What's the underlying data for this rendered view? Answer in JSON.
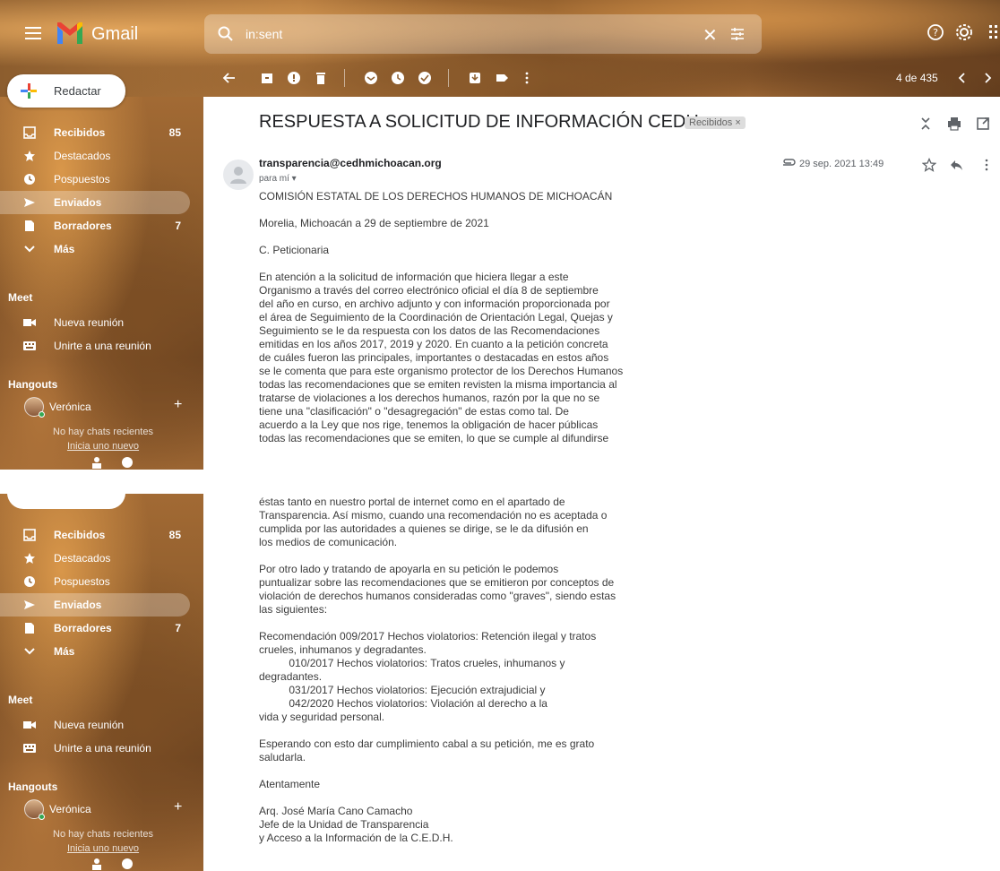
{
  "app": {
    "name": "Gmail"
  },
  "search": {
    "value": "in:sent"
  },
  "pager": {
    "text": "4 de 435"
  },
  "compose": {
    "label": "Redactar"
  },
  "nav": [
    {
      "label": "Recibidos",
      "count": "85"
    },
    {
      "label": "Destacados",
      "count": ""
    },
    {
      "label": "Pospuestos",
      "count": ""
    },
    {
      "label": "Enviados",
      "count": ""
    },
    {
      "label": "Borradores",
      "count": "7"
    },
    {
      "label": "Más",
      "count": ""
    }
  ],
  "meet": {
    "title": "Meet",
    "new_meeting": "Nueva reunión",
    "join_meeting": "Unirte a una reunión"
  },
  "hangouts": {
    "title": "Hangouts",
    "user": "Verónica",
    "no_chats": "No hay chats recientes",
    "start_new": "Inicia uno nuevo"
  },
  "email": {
    "subject": "RESPUESTA A SOLICITUD DE INFORMACIÓN CEDH",
    "label_chip": "Recibidos ×",
    "sender": "transparencia@cedhmichoacan.org",
    "recipient": "para mí ▾",
    "date": "29 sep. 2021 13:49",
    "body_part1": "COMISIÓN ESTATAL DE LOS DERECHOS HUMANOS DE MICHOACÁN\n\nMorelia, Michoacán a 29 de septiembre de 2021\n\nC. Peticionaria\n\nEn atención a la solicitud de información que hiciera llegar a este\nOrganismo a través del correo electrónico oficial el día 8 de septiembre\ndel año en curso, en archivo adjunto y con información proporcionada por\nel área de Seguimiento de la Coordinación de Orientación Legal, Quejas y\nSeguimiento se le da respuesta con los datos de las Recomendaciones\nemitidas en los años 2017, 2019 y 2020. En cuanto a la petición concreta\nde cuáles fueron las principales, importantes o destacadas en estos años\nse le comenta que para este organismo protector de los Derechos Humanos\ntodas las recomendaciones que se emiten revisten la misma importancia al\ntratarse de violaciones a los derechos humanos, razón por la que no se\ntiene una \"clasificación\" o \"desagregación\" de estas como tal. De\nacuerdo a la Ley que nos rige, tenemos la obligación de hacer públicas\ntodas las recomendaciones que se emiten, lo que se cumple al difundirse",
    "body_part2": "éstas tanto en nuestro portal de internet como en el apartado de\nTransparencia. Así mismo, cuando una recomendación no es aceptada o\ncumplida por las autoridades a quienes se dirige, se le da difusión en\nlos medios de comunicación.\n\nPor otro lado y tratando de apoyarla en su petición le podemos\npuntualizar sobre las recomendaciones que se emitieron por conceptos de\nviolación de derechos humanos consideradas como \"graves\", siendo estas\nlas siguientes:\n\nRecomendación 009/2017 Hechos violatorios: Retención ilegal y tratos\ncrueles, inhumanos y degradantes.\n          010/2017 Hechos violatorios: Tratos crueles, inhumanos y\ndegradantes.\n          031/2017 Hechos violatorios: Ejecución extrajudicial y\n          042/2020 Hechos violatorios: Violación al derecho a la\nvida y seguridad personal.\n\nEsperando con esto dar cumplimiento cabal a su petición, me es grato\nsaludarla.\n\nAtentamente\n\nArq. José María Cano Camacho\nJefe de la Unidad de Transparencia\ny Acceso a la Información de la C.E.D.H."
  },
  "colors": {
    "accent": "#ffffff",
    "gmail_red": "#ea4335",
    "gmail_blue": "#4285f4",
    "gmail_green": "#34a853",
    "gmail_yellow": "#fbbc04"
  }
}
